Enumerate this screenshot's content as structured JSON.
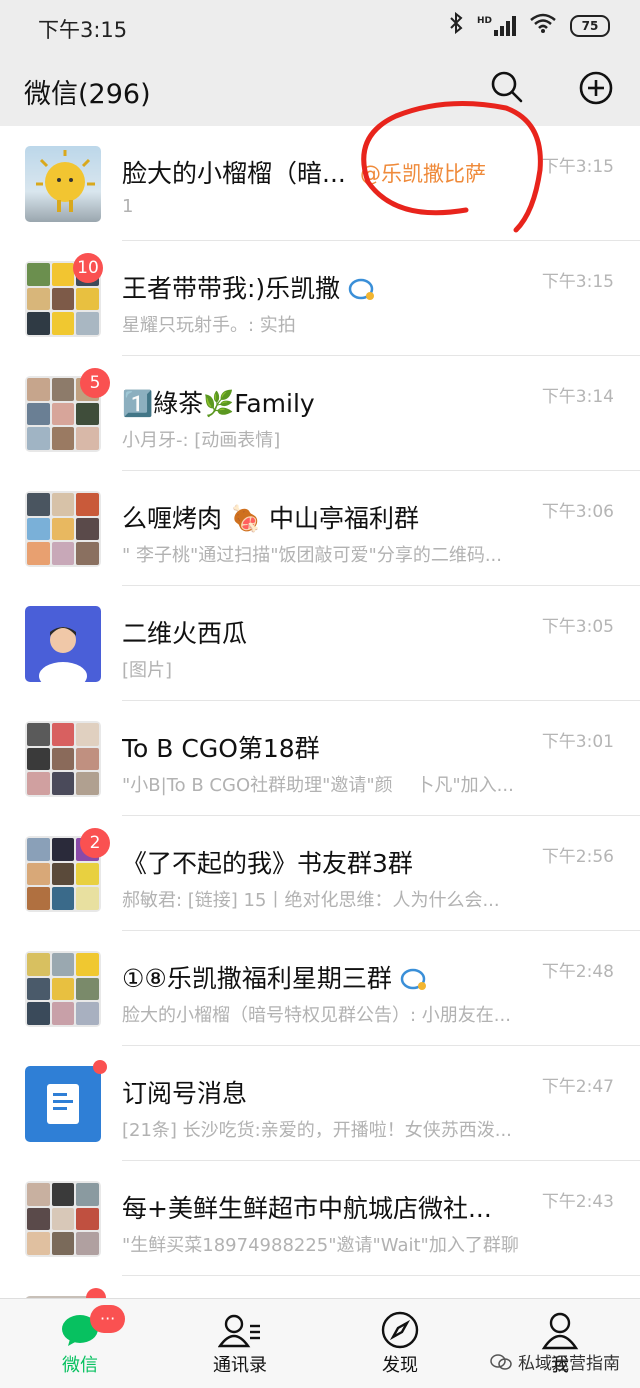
{
  "status_bar": {
    "time": "下午3:15",
    "battery": "75",
    "network": "HD"
  },
  "header": {
    "title": "微信(296)",
    "search_icon": "search-icon",
    "add_icon": "plus-circle-icon"
  },
  "chats": [
    {
      "name": "脸大的小榴榴（暗...",
      "mention": "@乐凯撒比萨",
      "preview": "1",
      "time": "下午3:15",
      "badge": ""
    },
    {
      "name": "王者带带我:)乐凯撒",
      "preview": "星耀只玩射手。: 实拍",
      "time": "下午3:15",
      "badge": "10"
    },
    {
      "name": "1️⃣綠茶🌿Family",
      "preview": "小月牙-: [动画表情]",
      "time": "下午3:14",
      "badge": "5"
    },
    {
      "name": "么喱烤肉 🍖 中山亭福利群",
      "preview": "\" 李子桃\"通过扫描\"饭团敲可爱\"分享的二维码...",
      "time": "下午3:06",
      "badge": ""
    },
    {
      "name": "二维火西瓜",
      "preview": "[图片]",
      "time": "下午3:05",
      "badge": ""
    },
    {
      "name": "To B CGO第18群",
      "preview": "\"小B|To B CGO社群助理\"邀请\"颜　 卜凡\"加入...",
      "time": "下午3:01",
      "badge": ""
    },
    {
      "name": "《了不起的我》书友群3群",
      "preview": "郝敏君: [链接] 15丨绝对化思维：人为什么会...",
      "time": "下午2:56",
      "badge": "2"
    },
    {
      "name": "①⑧乐凯撒福利星期三群",
      "preview": "脸大的小榴榴（暗号特权见群公告）: 小朋友在...",
      "time": "下午2:48",
      "badge": ""
    },
    {
      "name": "订阅号消息",
      "preview": "[21条] 长沙吃货:亲爱的，开播啦！女侠苏西泼...",
      "time": "下午2:47",
      "badge": ""
    },
    {
      "name": "每+美鲜生鲜超市中航城店微社...",
      "preview": "\"生鲜买菜18974988225\"邀请\"Wait\"加入了群聊",
      "time": "下午2:43",
      "badge": ""
    }
  ],
  "tabs": [
    {
      "label": "微信",
      "icon": "chat-bubble-icon",
      "badge": "···"
    },
    {
      "label": "通讯录",
      "icon": "contacts-icon"
    },
    {
      "label": "发现",
      "icon": "compass-icon"
    },
    {
      "label": "我",
      "icon": "person-icon"
    }
  ],
  "watermark": "私域运营指南",
  "colors": {
    "accent_green": "#07c160",
    "badge_red": "#fa5151",
    "annotation_red": "#e8241c",
    "mention_orange": "#ef8a3a"
  }
}
